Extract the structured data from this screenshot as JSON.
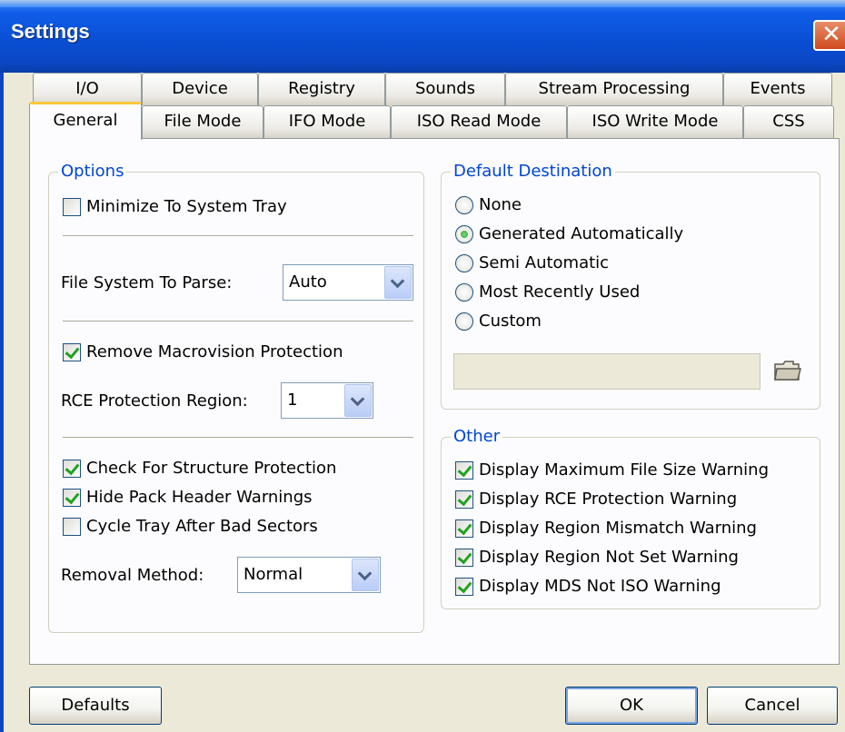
{
  "window": {
    "title": "Settings",
    "close_glyph": "✕"
  },
  "tabs_row1": [
    "I/O",
    "Device",
    "Registry",
    "Sounds",
    "Stream Processing",
    "Events"
  ],
  "tabs_row2": [
    "General",
    "File Mode",
    "IFO Mode",
    "ISO Read Mode",
    "ISO Write Mode",
    "CSS"
  ],
  "active_tab": "General",
  "options": {
    "label": "Options",
    "minimize_tray": {
      "label": "Minimize To System Tray",
      "checked": false
    },
    "file_system": {
      "label": "File System To Parse:",
      "value": "Auto"
    },
    "remove_macrovision": {
      "label": "Remove Macrovision Protection",
      "checked": true
    },
    "rce_region": {
      "label": "RCE Protection Region:",
      "value": "1"
    },
    "check_structure": {
      "label": "Check For Structure Protection",
      "checked": true
    },
    "hide_pack": {
      "label": "Hide Pack Header Warnings",
      "checked": true
    },
    "cycle_tray": {
      "label": "Cycle Tray After Bad Sectors",
      "checked": false
    },
    "removal_method": {
      "label": "Removal Method:",
      "value": "Normal"
    }
  },
  "destination": {
    "label": "Default Destination",
    "options": [
      "None",
      "Generated Automatically",
      "Semi Automatic",
      "Most Recently Used",
      "Custom"
    ],
    "selected": "Generated Automatically",
    "path_value": "",
    "browse_icon": "folder-icon"
  },
  "other": {
    "label": "Other",
    "items": [
      {
        "label": "Display Maximum File Size Warning",
        "checked": true
      },
      {
        "label": "Display RCE Protection Warning",
        "checked": true
      },
      {
        "label": "Display Region Mismatch Warning",
        "checked": true
      },
      {
        "label": "Display Region Not Set Warning",
        "checked": true
      },
      {
        "label": "Display MDS Not ISO Warning",
        "checked": true
      }
    ]
  },
  "buttons": {
    "defaults": "Defaults",
    "ok": "OK",
    "cancel": "Cancel"
  },
  "colors": {
    "titlebar": "#0a4fd4",
    "group_label": "#0046d5",
    "check": "#21a121",
    "dialog_bg": "#ece9d8"
  }
}
